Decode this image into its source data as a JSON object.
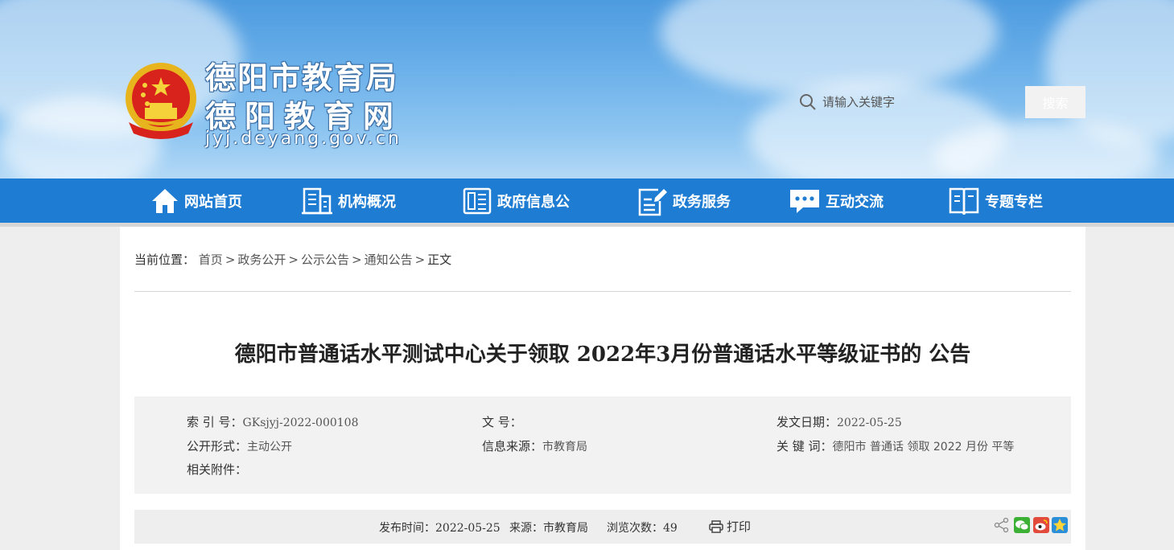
{
  "header": {
    "title_line1": "德阳市教育局",
    "title_line2": "德阳教育网",
    "domain": "jyj.deyang.gov.cn",
    "search_placeholder": "请输入关键字",
    "search_button": "搜索"
  },
  "nav": {
    "items": [
      {
        "label": "网站首页",
        "icon": "home-icon"
      },
      {
        "label": "机构概况",
        "icon": "building-icon"
      },
      {
        "label": "政府信息公",
        "icon": "document-icon"
      },
      {
        "label": "政务服务",
        "icon": "edit-icon"
      },
      {
        "label": "互动交流",
        "icon": "chat-icon"
      },
      {
        "label": "专题专栏",
        "icon": "book-icon"
      }
    ]
  },
  "breadcrumb": {
    "prefix": "当前位置：",
    "items": [
      "首页",
      "政务公开",
      "公示公告",
      "通知公告"
    ],
    "separator": ">",
    "current": "正文"
  },
  "article": {
    "title": "德阳市普通话水平测试中心关于领取 2022年3月份普通话水平等级证书的 公告"
  },
  "meta": {
    "index_label": "索 引 号：",
    "index_value": "GKsjyj-2022-000108",
    "docno_label": "文 号：",
    "docno_value": "",
    "date_label": "发文日期：",
    "date_value": "2022-05-25",
    "form_label": "公开形式：",
    "form_value": "主动公开",
    "source_label": "信息来源：",
    "source_value": "市教育局",
    "keywords_label": "关 键 词：",
    "keywords_value": "德阳市 普通话 领取 2022 月份 平等",
    "attach_label": "相关附件："
  },
  "info": {
    "publish_label": "发布时间：",
    "publish_value": "2022-05-25",
    "source_label": "来源：",
    "source_value": "市教育局",
    "views_label": "浏览次数：",
    "views_value": "49",
    "print_label": "打印"
  },
  "colors": {
    "nav_bg": "#1f7cd3",
    "header_sky": "#6cb1ea",
    "page_bg": "#eeeeee",
    "meta_bg": "#f2f2f2"
  }
}
